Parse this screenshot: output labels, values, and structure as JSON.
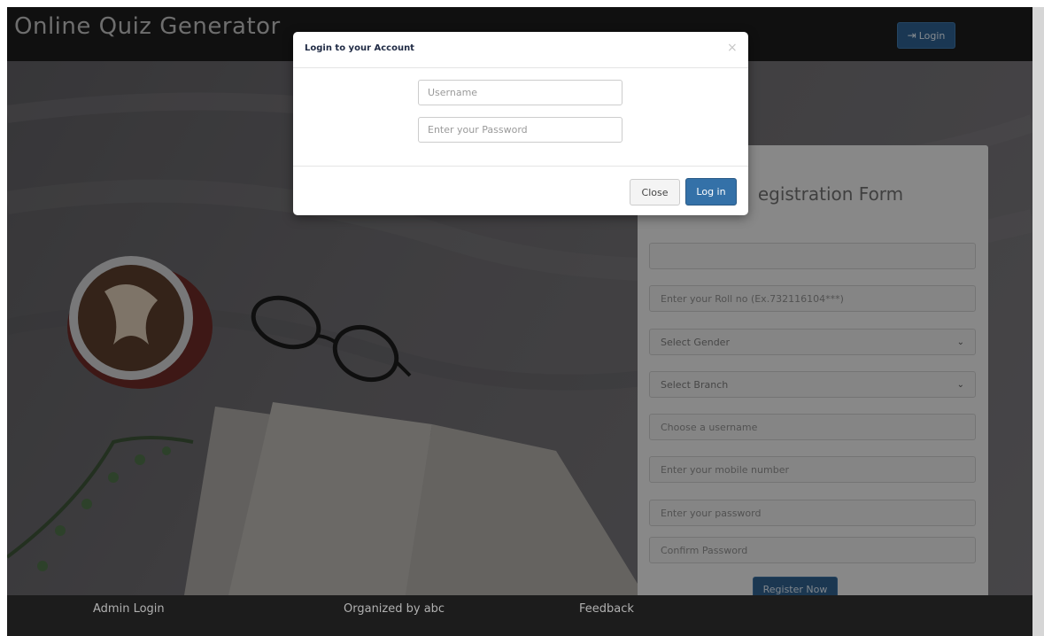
{
  "navbar": {
    "brand": "Online Quiz Generator",
    "login_label": "Login",
    "login_icon": "sign-in-icon"
  },
  "registration": {
    "title": "egistration Form",
    "fields": [
      {
        "name": "full-name-input",
        "placeholder": ""
      },
      {
        "name": "roll-no-input",
        "placeholder": "Enter your Roll no (Ex.732116104***)"
      },
      {
        "name": "gender-select",
        "placeholder": "Select Gender",
        "type": "select"
      },
      {
        "name": "branch-select",
        "placeholder": "Select Branch",
        "type": "select"
      },
      {
        "name": "username-input",
        "placeholder": "Choose a username"
      },
      {
        "name": "mobile-input",
        "placeholder": "Enter your mobile number"
      },
      {
        "name": "password-input",
        "placeholder": "Enter your password"
      },
      {
        "name": "confirm-password-input",
        "placeholder": "Confirm Password"
      }
    ],
    "register_label": "Register Now"
  },
  "modal": {
    "title": "Login to your Account",
    "close_glyph": "×",
    "username_placeholder": "Username",
    "password_placeholder": "Enter your Password",
    "close_label": "Close",
    "login_label": "Log in"
  },
  "footer": {
    "admin_login": "Admin Login",
    "organized_by": "Organized by abc",
    "feedback": "Feedback"
  },
  "colors": {
    "navbar_bg": "#1c1c1c",
    "primary_button": "#3471a8",
    "overlay": "rgba(0,0,0,0.42)"
  }
}
